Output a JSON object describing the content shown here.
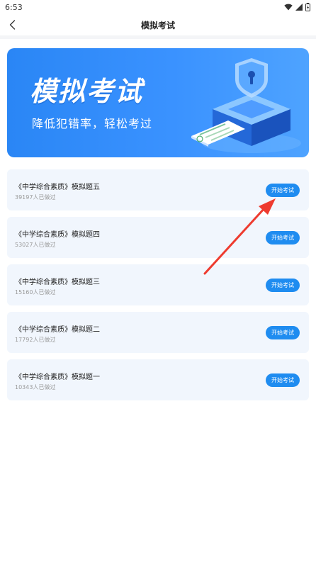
{
  "status_bar": {
    "time": "6:53",
    "icons": [
      "wifi-icon",
      "cell-signal-icon",
      "battery-icon"
    ]
  },
  "nav": {
    "title": "模拟考试",
    "back_icon": "chevron-left-icon"
  },
  "banner": {
    "title": "模拟考试",
    "subtitle": "降低犯错率，轻松考过"
  },
  "exams": [
    {
      "title": "《中学综合素质》模拟题五",
      "count": "39197人已做过",
      "button": "开始考试"
    },
    {
      "title": "《中学综合素质》模拟题四",
      "count": "53027人已做过",
      "button": "开始考试"
    },
    {
      "title": "《中学综合素质》模拟题三",
      "count": "15160人已做过",
      "button": "开始考试"
    },
    {
      "title": "《中学综合素质》模拟题二",
      "count": "17792人已做过",
      "button": "开始考试"
    },
    {
      "title": "《中学综合素质》模拟题一",
      "count": "10343人已做过",
      "button": "开始考试"
    }
  ],
  "colors": {
    "accent": "#1f8cf0",
    "card_bg": "#f1f6fd",
    "banner": "#3a92ff",
    "annotation_arrow": "#ee3b2f"
  }
}
